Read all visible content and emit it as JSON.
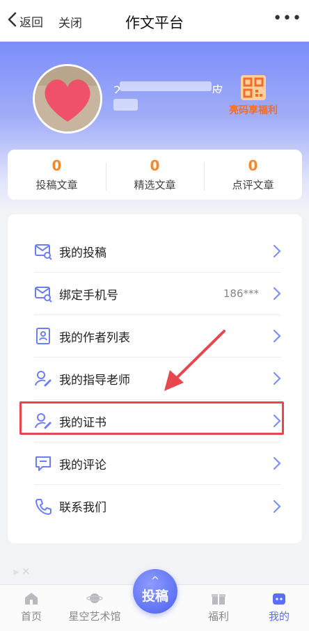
{
  "nav": {
    "back_label": "返回",
    "close_label": "关闭",
    "title": "作文平台",
    "more_label": "•••"
  },
  "profile": {
    "name_prefix": "2",
    "name_suffix": "皮",
    "qr_label": "亮码享福利"
  },
  "stats": [
    {
      "value": "0",
      "label": "投稿文章"
    },
    {
      "value": "0",
      "label": "精选文章"
    },
    {
      "value": "0",
      "label": "点评文章"
    }
  ],
  "menu": [
    {
      "label": "我的投稿",
      "icon": "mail-search-icon"
    },
    {
      "label": "绑定手机号",
      "value": "186***",
      "icon": "mail-search-icon"
    },
    {
      "label": "我的作者列表",
      "icon": "id-card-icon"
    },
    {
      "label": "我的指导老师",
      "icon": "user-edit-icon"
    },
    {
      "label": "我的证书",
      "icon": "user-edit-icon"
    },
    {
      "label": "我的评论",
      "icon": "comment-icon"
    },
    {
      "label": "联系我们",
      "icon": "phone-icon"
    }
  ],
  "tabbar": {
    "home": "首页",
    "gallery": "星空艺术馆",
    "submit": "投稿",
    "welfare": "福利",
    "mine": "我的",
    "submit_caret": "^"
  },
  "overlay": {
    "faint_text": "⫸       ✕"
  },
  "colors": {
    "accent": "#5a6ff5",
    "stat_number": "#f5882a",
    "highlight_box": "#e5474d"
  }
}
